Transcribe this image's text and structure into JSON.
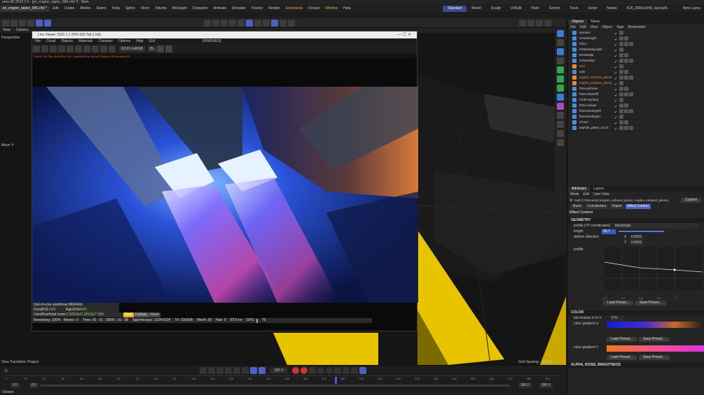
{
  "window": {
    "title": "ema 4D 2023.2.0 - [jet_engine_raptor_006.c4d *] - Main"
  },
  "doc_tabs": [
    "jet_engine_raptor_006.c4d *"
  ],
  "menu": [
    "Edit",
    "Create",
    "Modes",
    "Select",
    "Tools",
    "Spline",
    "Mesh",
    "Volume",
    "MoGraph",
    "Character",
    "Animate",
    "Simulate",
    "Tracker",
    "Render",
    "Extensions",
    "Octane",
    "Window",
    "Help"
  ],
  "layout_tabs": [
    "Standard",
    "Model",
    "Sculpt",
    "UVEdit",
    "Paint",
    "Groom",
    "Track",
    "Script",
    "Nodes",
    "K26_2560x1440_layout36"
  ],
  "new_layout": "New Layou",
  "viewport": {
    "menu": [
      "View",
      "Camera"
    ],
    "label": "Perspective",
    "move_label": "Move",
    "status_left": "View Transform: Project",
    "status_right": "Grid Spacing : 500 cm"
  },
  "octane": {
    "title": "Live Viewer 2022.1.1 (PID:320 Tail:1 full)",
    "menu": [
      "File",
      "Cloud",
      "Objects",
      "Materials",
      "Compare",
      "Options",
      "Help",
      "GUI"
    ],
    "finished": "[FINISHED]",
    "ocio": "OCIO->sRGB",
    "dl": "DL",
    "status": "Check:Tris:Tris, MeshGen:Tris, Updated:0ms, Mesh:2 Nodes:135 Movable:29",
    "stats": {
      "ooc": "Out-of-core used/max:0Kb/4Gb",
      "grey": "Grey8/16: ",
      "grey_v": "10/0",
      "rgb": "Rgb32/64: ",
      "rgb_v": "4/0",
      "vram": "Used/free/total vram: ",
      "vram_v": "2.083Gb/2.185Gb/7.999",
      "main": "Main",
      "demain": "DeMain",
      "noise": "Noise",
      "rendering": "Rendering: 100%",
      "ms": "Ms/sec: 0",
      "time": "Time: 00 : 01 : 08/00 : 01 : 08",
      "spp": "Spp/maxspp: 1024/1024",
      "tri": "Tri: 21k/50k",
      "mesh": "Mesh: 39",
      "hair": "Hair: 0",
      "rtx": "RTX:on",
      "gpu": "GPU:",
      "gpu_v": "75"
    }
  },
  "objects_panel": {
    "tabs": [
      "Objects",
      "Takes"
    ],
    "menu": [
      "File",
      "Edit",
      "View",
      "Object",
      "Tags",
      "Bookmarks"
    ],
    "rows": [
      {
        "name": "xpresso",
        "orange": false
      },
      {
        "name": "OctaneLight",
        "orange": false
      },
      {
        "name": "Floor",
        "orange": false
      },
      {
        "name": "OctaneDayLight",
        "orange": false
      },
      {
        "name": "Rectangle",
        "orange": false
      },
      {
        "name": "OctaneSky",
        "orange": false
      },
      {
        "name": "Null",
        "orange": true
      },
      {
        "name": "cam",
        "orange": false
      },
      {
        "name": "engine_exhaust_plume",
        "orange": true
      },
      {
        "name": "engine_exhaust_plume",
        "orange": true
      },
      {
        "name": "f22a-airframe",
        "orange": false
      },
      {
        "name": "f22a-refuelOff",
        "orange": false
      },
      {
        "name": "Cloth Surface",
        "orange": false
      },
      {
        "name": "f22a-cockpit",
        "orange": false
      },
      {
        "name": "f22a-landingOff",
        "orange": false
      },
      {
        "name": "f22a-landingOn",
        "orange": false
      },
      {
        "name": "Cloner",
        "orange": false
      },
      {
        "name": "asphalt_plane_v1.02",
        "orange": false
      }
    ]
  },
  "attributes": {
    "tabs": [
      "Attributes",
      "Layers"
    ],
    "menu": [
      "Mode",
      "Edit",
      "User Data"
    ],
    "object_line": "Null (2 Elements) [engine_exhaust_plume, engine_exhaust_plume]",
    "custom": "Custom",
    "sub_tabs": [
      "Basic",
      "Coordinates",
      "Object",
      "Effect Control"
    ],
    "effect_title": "Effect Control",
    "geometry": "GEOMETRY",
    "profile_xy": "profile (XY coordinates)",
    "rectangle": "Rectangle",
    "length_label": "length",
    "length_value": "95.7",
    "deform_label": "deform direction",
    "x_label": "X",
    "x_value": "0.0001",
    "y_label": "Y",
    "y_value": "0.0001",
    "profile_label": "profile",
    "load_preset": "Load Preset...",
    "save_preset": "Save Preset...",
    "color": "COLOR",
    "mix_label": "mix texture U to V",
    "mix_value": "0 %",
    "grad_u": "color gradient U",
    "grad_v": "color gradient V",
    "alpha_section": "ALPHA, NOISE, BRIGHTNESS",
    "graph_ticks": [
      "0.2",
      "0.4",
      "0.6",
      "0.8",
      "1"
    ]
  },
  "timeline": {
    "ticks": [
      "0",
      "10",
      "20",
      "30",
      "40",
      "50",
      "60",
      "70",
      "80",
      "90",
      "100",
      "110",
      "120",
      "130",
      "140",
      "150",
      "160",
      "170",
      "180",
      "190",
      "200",
      "210",
      "220",
      "230",
      "240",
      "250",
      "260",
      "270",
      "280",
      "290"
    ],
    "frame": "181 F",
    "start": "0 F",
    "start2": "0 F",
    "end": "300 F",
    "end2": "300 F"
  },
  "footer": "Octane:"
}
